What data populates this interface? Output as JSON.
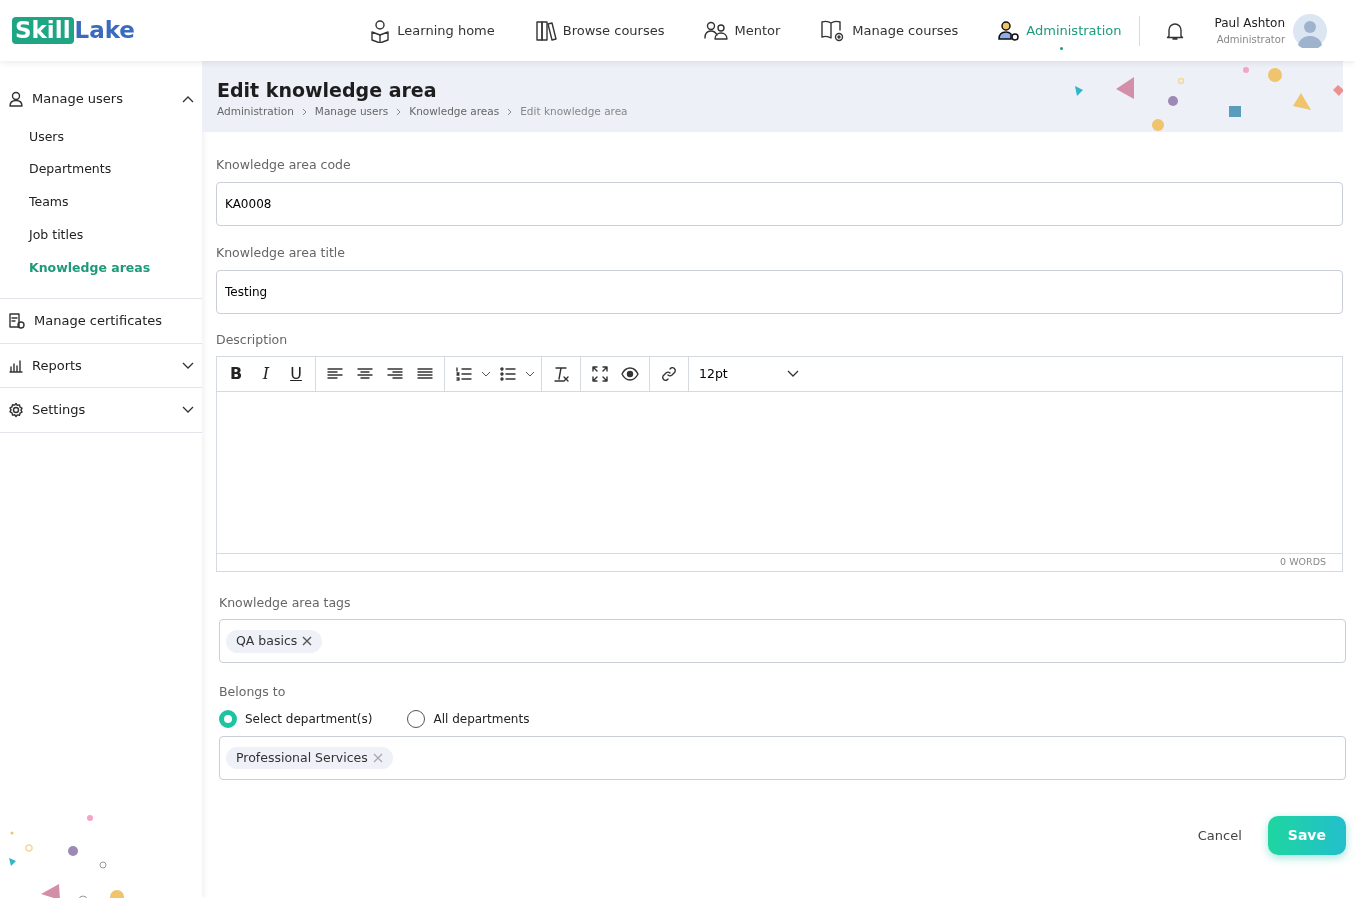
{
  "logo": {
    "badge_text": "Skill",
    "text": "Lake"
  },
  "nav": [
    {
      "label": "Learning home",
      "selected": false
    },
    {
      "label": "Browse courses",
      "selected": false
    },
    {
      "label": "Mentor",
      "selected": false
    },
    {
      "label": "Manage courses",
      "selected": false
    },
    {
      "label": "Administration",
      "selected": true
    }
  ],
  "user": {
    "name": "Paul Ashton",
    "role": "Administrator"
  },
  "sidebar": [
    {
      "label": "Manage users",
      "expanded": true,
      "children": [
        {
          "label": "Users",
          "selected": false
        },
        {
          "label": "Departments",
          "selected": false
        },
        {
          "label": "Teams",
          "selected": false
        },
        {
          "label": "Job titles",
          "selected": false
        },
        {
          "label": "Knowledge areas",
          "selected": true
        }
      ]
    },
    {
      "label": "Manage certificates"
    },
    {
      "label": "Reports",
      "expanded": false
    },
    {
      "label": "Settings",
      "expanded": false
    }
  ],
  "page": {
    "title": "Edit knowledge area",
    "breadcrumb": [
      "Administration",
      "Manage users",
      "Knowledge areas",
      "Edit knowledge area"
    ]
  },
  "form": {
    "code": {
      "label": "Knowledge area code",
      "value": "KA0008"
    },
    "title": {
      "label": "Knowledge area title",
      "value": "Testing"
    },
    "description": {
      "label": "Description",
      "word_count": "0 WORDS",
      "font_size": "12pt",
      "format_buttons": [
        "B",
        "I",
        "U"
      ]
    },
    "tags": {
      "label": "Knowledge area tags",
      "items": [
        "QA basics"
      ]
    },
    "belongs": {
      "label": "Belongs to",
      "options": [
        {
          "label": "Select department(s)",
          "selected": true
        },
        {
          "label": "All departments",
          "selected": false
        }
      ],
      "items": [
        "Professional Services"
      ]
    },
    "buttons": {
      "cancel": "Cancel",
      "save": "Save"
    }
  }
}
